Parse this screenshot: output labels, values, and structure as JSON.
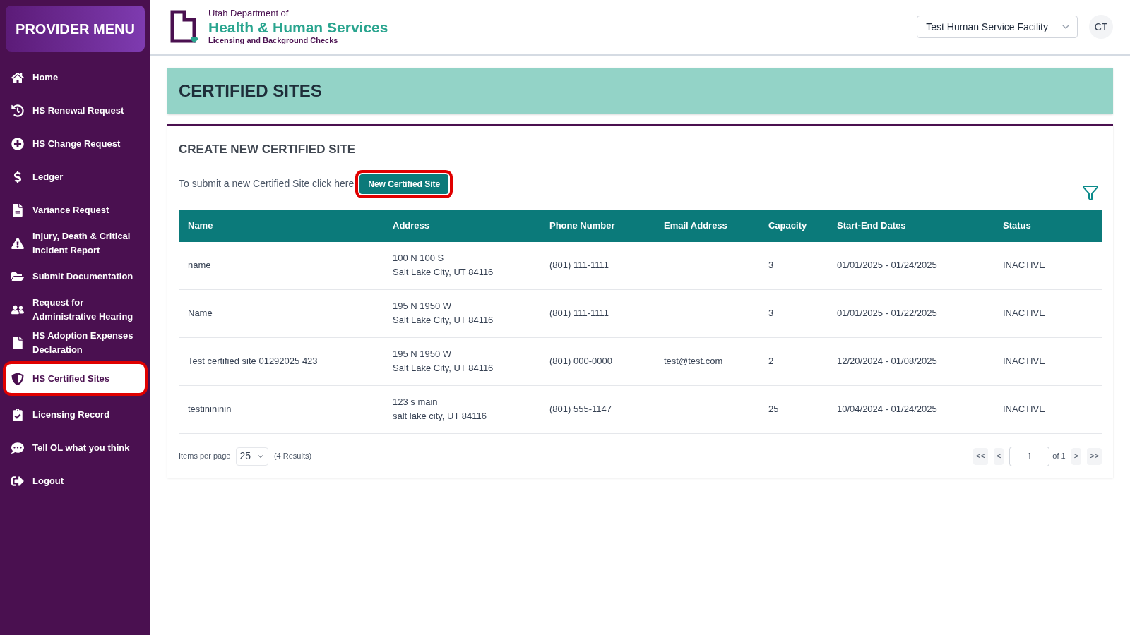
{
  "sidebar": {
    "title": "PROVIDER MENU",
    "items": [
      {
        "label": "Home",
        "selected": false,
        "highlighted": false
      },
      {
        "label": "HS Renewal Request",
        "selected": false,
        "highlighted": false
      },
      {
        "label": "HS Change Request",
        "selected": false,
        "highlighted": false
      },
      {
        "label": "Ledger",
        "selected": false,
        "highlighted": false
      },
      {
        "label": "Variance Request",
        "selected": false,
        "highlighted": false
      },
      {
        "label": "Injury, Death & Critical Incident Report",
        "selected": false,
        "highlighted": false
      },
      {
        "label": "Submit Documentation",
        "selected": false,
        "highlighted": false
      },
      {
        "label": "Request for Administrative Hearing",
        "selected": false,
        "highlighted": false
      },
      {
        "label": "HS Adoption Expenses Declaration",
        "selected": false,
        "highlighted": false
      },
      {
        "label": "HS Certified Sites",
        "selected": true,
        "highlighted": true
      },
      {
        "label": "Licensing Record",
        "selected": false,
        "highlighted": false
      },
      {
        "label": "Tell OL what you think",
        "selected": false,
        "highlighted": false
      },
      {
        "label": "Logout",
        "selected": false,
        "highlighted": false
      }
    ]
  },
  "header": {
    "logo": {
      "line1": "Utah Department of",
      "line2": "Health & Human Services",
      "line3": "Licensing and Background Checks"
    },
    "facility_select": "Test Human Service Facility",
    "avatar": "CT"
  },
  "page_title": "CERTIFIED SITES",
  "create": {
    "heading": "CREATE NEW CERTIFIED SITE",
    "text": "To submit a new Certified Site click here",
    "button": "New Certified Site",
    "button_highlighted": true
  },
  "table": {
    "columns": [
      "Name",
      "Address",
      "Phone Number",
      "Email Address",
      "Capacity",
      "Start-End Dates",
      "Status"
    ],
    "rows": [
      {
        "name": "name",
        "address": [
          "100 N 100 S",
          "Salt Lake City, UT 84116"
        ],
        "phone": "(801) 111-1111",
        "email": "",
        "capacity": "3",
        "dates": "01/01/2025 - 01/24/2025",
        "status": "INACTIVE"
      },
      {
        "name": "Name",
        "address": [
          "195 N 1950 W",
          "Salt Lake City, UT 84116"
        ],
        "phone": "(801) 111-1111",
        "email": "",
        "capacity": "3",
        "dates": "01/01/2025 - 01/22/2025",
        "status": "INACTIVE"
      },
      {
        "name": "Test certified site 01292025 423",
        "address": [
          "195 N 1950 W",
          "Salt Lake City, UT 84116"
        ],
        "phone": "(801) 000-0000",
        "email": "test@test.com",
        "capacity": "2",
        "dates": "12/20/2024 - 01/08/2025",
        "status": "INACTIVE"
      },
      {
        "name": "testinininin",
        "address": [
          "123 s main",
          "salt lake city, UT 84116"
        ],
        "phone": "(801) 555-1147",
        "email": "",
        "capacity": "25",
        "dates": "10/04/2024 - 01/24/2025",
        "status": "INACTIVE"
      }
    ]
  },
  "pagination": {
    "items_per_page_label": "Items per page",
    "items_per_page": "25",
    "results": "(4 Results)",
    "first": "<<",
    "prev": "<",
    "page": "1",
    "of": "of 1",
    "next": ">",
    "last": ">>"
  }
}
